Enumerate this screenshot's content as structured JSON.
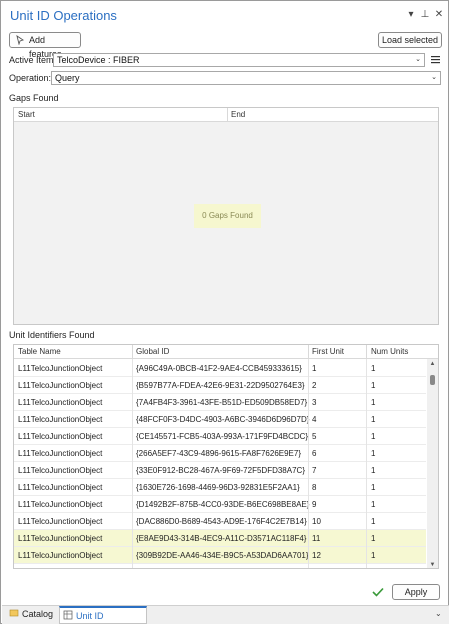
{
  "window": {
    "title": "Unit ID Operations",
    "controls": [
      "chevron-down-icon",
      "pin-icon",
      "close-icon"
    ]
  },
  "toolbar": {
    "add_features_label": "Add features",
    "load_selected_label": "Load selected"
  },
  "form": {
    "active_item_label": "Active Item:",
    "active_item_value": "TelcoDevice : FIBER",
    "operation_label": "Operation:",
    "operation_value": "Query"
  },
  "gaps": {
    "section_title": "Gaps Found",
    "columns": [
      "Start",
      "End"
    ],
    "empty_message": "0 Gaps Found"
  },
  "units": {
    "section_title": "Unit Identifiers Found",
    "columns": [
      "Table Name",
      "Global ID",
      "First Unit",
      "Num Units"
    ],
    "rows": [
      {
        "table": "L11TelcoJunctionObject",
        "gid": "{A96C49A-0BCB-41F2-9AE4-CCB459333615}",
        "first": "1",
        "num": "1"
      },
      {
        "table": "L11TelcoJunctionObject",
        "gid": "{B597B77A-FDEA-42E6-9E31-22D9502764E3}",
        "first": "2",
        "num": "1"
      },
      {
        "table": "L11TelcoJunctionObject",
        "gid": "{7A4FB4F3-3961-43FE-B51D-ED509DB58ED7}",
        "first": "3",
        "num": "1"
      },
      {
        "table": "L11TelcoJunctionObject",
        "gid": "{48FCF0F3-D4DC-4903-A6BC-3946D6D96D7D}",
        "first": "4",
        "num": "1"
      },
      {
        "table": "L11TelcoJunctionObject",
        "gid": "{CE145571-FCB5-403A-993A-171F9FD4BCDC}",
        "first": "5",
        "num": "1"
      },
      {
        "table": "L11TelcoJunctionObject",
        "gid": "{266A5EF7-43C9-4896-9615-FA8F7626E9E7}",
        "first": "6",
        "num": "1"
      },
      {
        "table": "L11TelcoJunctionObject",
        "gid": "{33E0F912-BC28-467A-9F69-72F5DFD38A7C}",
        "first": "7",
        "num": "1"
      },
      {
        "table": "L11TelcoJunctionObject",
        "gid": "{1630E726-1698-4469-96D3-92831E5F2AA1}",
        "first": "8",
        "num": "1"
      },
      {
        "table": "L11TelcoJunctionObject",
        "gid": "{D1492B2F-875B-4CC0-93DE-B6EC698BE8AE}",
        "first": "9",
        "num": "1"
      },
      {
        "table": "L11TelcoJunctionObject",
        "gid": "{DAC886D0-B689-4543-AD9E-176F4C2E7B14}",
        "first": "10",
        "num": "1"
      },
      {
        "table": "L11TelcoJunctionObject",
        "gid": "{E8AE9D43-314B-4EC9-A11C-D3571AC118F4}",
        "first": "11",
        "num": "1",
        "selected": true
      },
      {
        "table": "L11TelcoJunctionObject",
        "gid": "{309B92DE-AA46-434E-B9C5-A53DAD6AA701}",
        "first": "12",
        "num": "1",
        "selected": true
      }
    ]
  },
  "footer": {
    "apply_label": "Apply",
    "check_icon": "checkmark-icon"
  },
  "tabs": {
    "catalog_label": "Catalog",
    "unit_ops_label": "Unit ID Operations"
  },
  "colors": {
    "accent": "#2b6fc2",
    "selection": "#f6f8d2",
    "check": "#3a9a3a"
  }
}
